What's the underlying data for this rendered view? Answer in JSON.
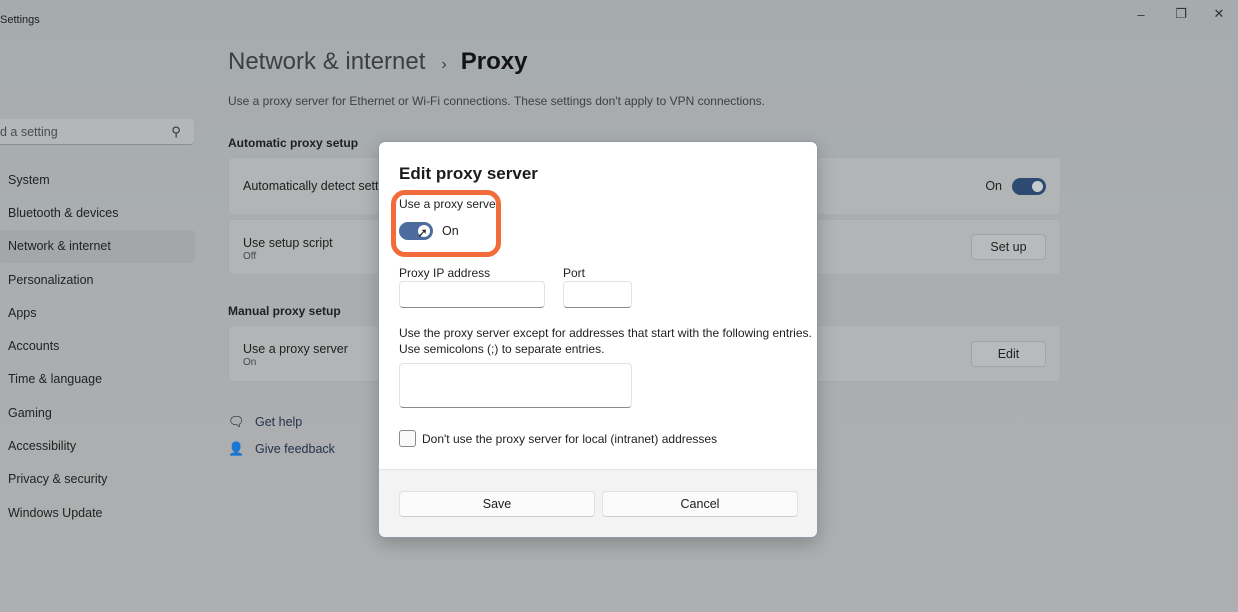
{
  "window": {
    "title": "Settings",
    "controls": {
      "minimize": "–",
      "maximize": "❐",
      "close": "✕"
    }
  },
  "search": {
    "placeholder": "d a setting",
    "icon": "search-icon"
  },
  "sidebar": {
    "items": [
      {
        "label": "System"
      },
      {
        "label": "Bluetooth & devices"
      },
      {
        "label": "Network & internet",
        "active": true
      },
      {
        "label": "Personalization"
      },
      {
        "label": "Apps"
      },
      {
        "label": "Accounts"
      },
      {
        "label": "Time & language"
      },
      {
        "label": "Gaming"
      },
      {
        "label": "Accessibility"
      },
      {
        "label": "Privacy & security"
      },
      {
        "label": "Windows Update"
      }
    ]
  },
  "header": {
    "breadcrumb_parent": "Network & internet",
    "breadcrumb_separator": "›",
    "breadcrumb_current": "Proxy",
    "description": "Use a proxy server for Ethernet or Wi-Fi connections. These settings don't apply to VPN connections."
  },
  "automatic": {
    "section_title": "Automatic proxy setup",
    "detect": {
      "title": "Automatically detect settings",
      "visible_title": "Automatically detect settir",
      "state": "On"
    },
    "script": {
      "title": "Use setup script",
      "subtitle": "Off",
      "button": "Set up"
    }
  },
  "manual": {
    "section_title": "Manual proxy setup",
    "proxy": {
      "title": "Use a proxy server",
      "subtitle": "On",
      "button": "Edit"
    }
  },
  "help": {
    "get_help": "Get help",
    "give_feedback": "Give feedback"
  },
  "dialog": {
    "title": "Edit proxy server",
    "toggle_label": "Use a proxy server",
    "toggle_state": "On",
    "ip_label": "Proxy IP address",
    "ip_value": "",
    "port_label": "Port",
    "port_value": "",
    "exceptions_line1": "Use the proxy server except for addresses that start with the following entries.",
    "exceptions_line2": "Use semicolons (;) to separate entries.",
    "exceptions_value": "",
    "local_checkbox_label": "Don't use the proxy server for local (intranet) addresses",
    "local_checkbox_checked": false,
    "save_label": "Save",
    "cancel_label": "Cancel"
  },
  "colors": {
    "accent": "#2d4a73",
    "dialog_toggle": "#4c6c9e",
    "highlight": "#f26b3a"
  }
}
